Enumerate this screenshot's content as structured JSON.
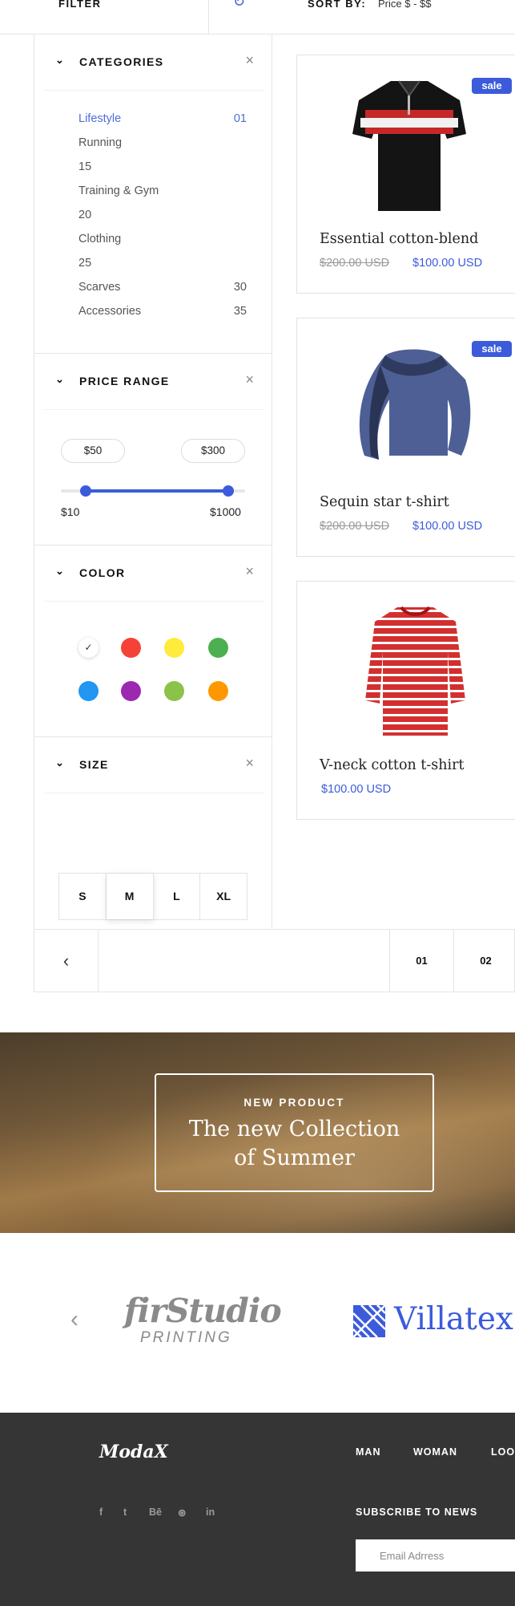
{
  "topbar": {
    "filter_label": "FILTER",
    "sort_label": "SORT BY:",
    "sort_value": "Price $ - $$"
  },
  "sidebar": {
    "categories": {
      "title": "CATEGORIES",
      "items": [
        {
          "label": "Lifestyle",
          "count": "01"
        },
        {
          "label": "Running",
          "count": ""
        },
        {
          "label": "15",
          "count": ""
        },
        {
          "label": "Training & Gym",
          "count": ""
        },
        {
          "label": "20",
          "count": ""
        },
        {
          "label": "Clothing",
          "count": ""
        },
        {
          "label": "25",
          "count": ""
        },
        {
          "label": "Scarves",
          "count": "30"
        },
        {
          "label": "Accessories",
          "count": "35"
        }
      ]
    },
    "price_range": {
      "title": "PRICE RANGE",
      "min_value": "$50",
      "max_value": "$300",
      "min_label": "$10",
      "max_label": "$1000"
    },
    "color": {
      "title": "COLOR",
      "swatches": [
        "#ffffff",
        "#f44336",
        "#ffeb3b",
        "#4caf50",
        "#2196f3",
        "#9c27b0",
        "#8bc34a",
        "#ff9800"
      ],
      "selected_index": 0
    },
    "size": {
      "title": "SIZE",
      "options": [
        "S",
        "M",
        "L",
        "XL"
      ],
      "selected": "M"
    }
  },
  "products": [
    {
      "name": "Essential cotton-blend",
      "old_price": "$200.00 USD",
      "price": "$100.00 USD",
      "badge": "sale"
    },
    {
      "name": "Sequin star t-shirt",
      "old_price": "$200.00 USD",
      "price": "$100.00 USD",
      "badge": "sale"
    },
    {
      "name": "V-neck cotton t-shirt",
      "old_price": "",
      "price": "$100.00 USD",
      "badge": ""
    }
  ],
  "pagination": {
    "pages": [
      "01",
      "02"
    ]
  },
  "banner": {
    "kicker": "NEW PRODUCT",
    "title_line1": "The new Collection",
    "title_line2": "of Summer"
  },
  "logos": {
    "fir_main": "firStudio",
    "fir_sub": "PRINTING",
    "villatex": "Villatex"
  },
  "footer": {
    "brand": "ModaX",
    "nav": [
      "MAN",
      "WOMAN",
      "LOOK"
    ],
    "social": [
      "f",
      "t",
      "Bē",
      "⊛",
      "in"
    ],
    "subscribe_title": "SUBSCRIBE TO NEWS",
    "email_placeholder": "Email Adrress"
  },
  "colors": {
    "accent": "#3b5bdb",
    "footer_bg": "#353535"
  }
}
